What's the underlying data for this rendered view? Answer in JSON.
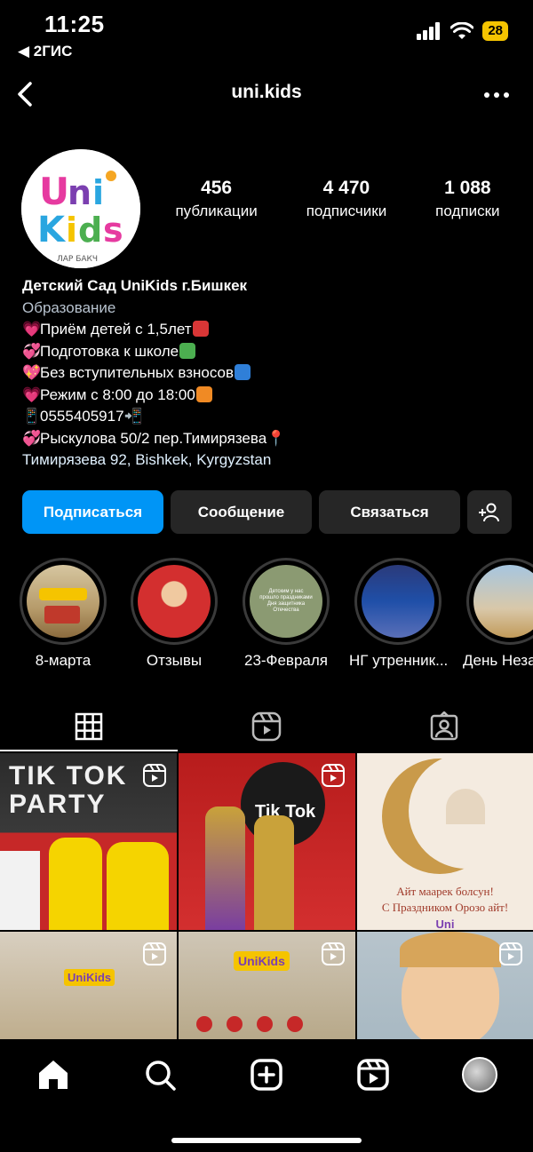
{
  "status_bar": {
    "time": "11:25",
    "back_app": "◀ 2ГИС",
    "battery": "28",
    "battery_color": "#f5c400"
  },
  "header": {
    "username": "uni.kids",
    "back_icon": "chevron-left-icon",
    "more_icon": "more-horizontal-icon"
  },
  "profile": {
    "avatar_logo_text": "UniKids",
    "stats": [
      {
        "value": "456",
        "label": "публикации"
      },
      {
        "value": "4 470",
        "label": "подписчики"
      },
      {
        "value": "1 088",
        "label": "подписки"
      }
    ],
    "name": "Детский Сад UniKids г.Бишкек",
    "category": "Образование",
    "bio_lines": [
      "Приём детей с 1,5лет",
      "Подготовка к школе",
      "Без вступительных взносов",
      "Режим с 8:00 до 18:00",
      "0555405917",
      "Рыскулова 50/2 пер.Тимирязева"
    ],
    "address": "Тимирязева 92, Bishkek, Kyrgyzstan"
  },
  "actions": {
    "follow": "Подписаться",
    "message": "Сообщение",
    "contact": "Связаться",
    "add_user_icon": "add-user-icon"
  },
  "highlights": [
    {
      "label": "8-марта"
    },
    {
      "label": "Отзывы"
    },
    {
      "label": "23-Февраля",
      "cover_text": "Детским у нас прошло праздниками Дня защитника Отечества"
    },
    {
      "label": "НГ утренник..."
    },
    {
      "label": "День Неза"
    }
  ],
  "tabs": [
    {
      "icon": "grid-icon",
      "active": true
    },
    {
      "icon": "reels-icon",
      "active": false
    },
    {
      "icon": "tagged-icon",
      "active": false
    }
  ],
  "posts": [
    {
      "type": "reel",
      "caption": "TIK TOK PARTY"
    },
    {
      "type": "reel",
      "caption": "Tik Tok"
    },
    {
      "type": "image",
      "caption_line1": "Айт маарек болсун!",
      "caption_line2": "С Праздником Орозо айт!",
      "logo": "Uni"
    },
    {
      "type": "reel",
      "caption": "UniKids"
    },
    {
      "type": "reel",
      "caption": "UniKids"
    },
    {
      "type": "reel",
      "caption": ""
    }
  ],
  "bottom_nav": [
    "home-icon",
    "search-icon",
    "create-icon",
    "reels-icon",
    "profile-avatar"
  ],
  "colors": {
    "accent": "#0095f6",
    "button_bg": "#262626",
    "category": "#b8c3cf"
  }
}
